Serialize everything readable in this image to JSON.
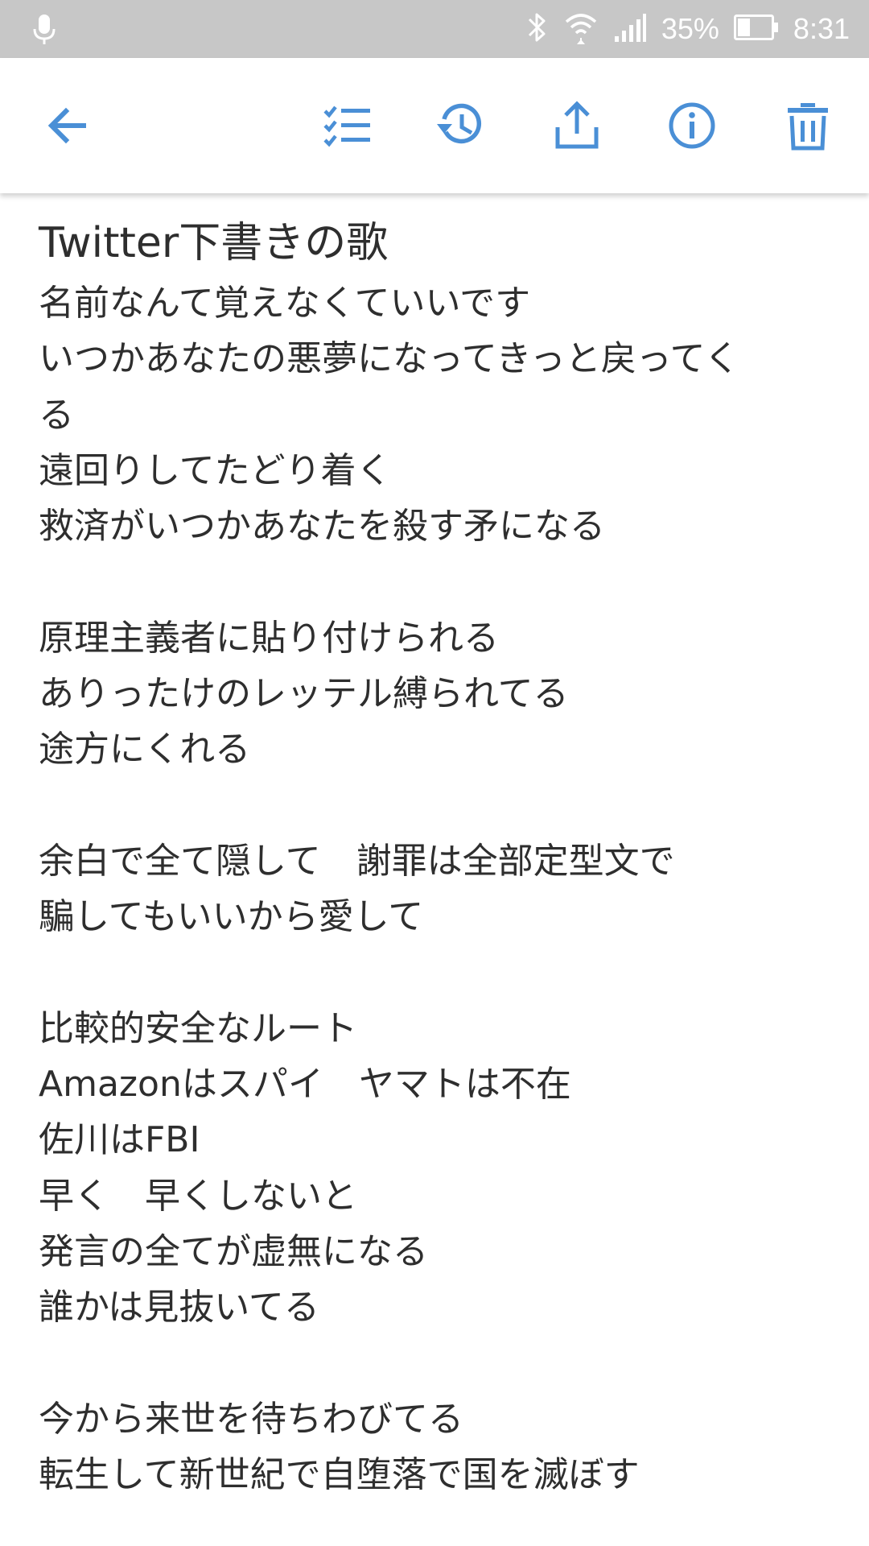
{
  "status_bar": {
    "battery_percent": "35%",
    "time": "8:31",
    "icons": [
      "mic-icon",
      "bluetooth-icon",
      "wifi-icon",
      "signal-icon",
      "battery-icon"
    ]
  },
  "toolbar": {
    "icons": [
      "back-arrow-icon",
      "checklist-icon",
      "history-icon",
      "share-icon",
      "info-icon",
      "trash-icon"
    ],
    "accent_color": "#4a8fd6"
  },
  "note": {
    "title": "Twitter下書きの歌",
    "lines": [
      "名前なんて覚えなくていいです",
      "いつかあなたの悪夢になってきっと戻ってく",
      "る",
      "遠回りしてたどり着く",
      "救済がいつかあなたを殺す矛になる",
      "",
      "原理主義者に貼り付けられる",
      "ありったけのレッテル縛られてる",
      "途方にくれる",
      "",
      "余白で全て隠して　謝罪は全部定型文で",
      "騙してもいいから愛して",
      "",
      "比較的安全なルート",
      "Amazonはスパイ　ヤマトは不在",
      "佐川はFBI",
      "早く　早くしないと",
      "発言の全てが虚無になる",
      "誰かは見抜いてる",
      "",
      "今から来世を待ちわびてる",
      "転生して新世紀で自堕落で国を滅ぼす"
    ]
  }
}
